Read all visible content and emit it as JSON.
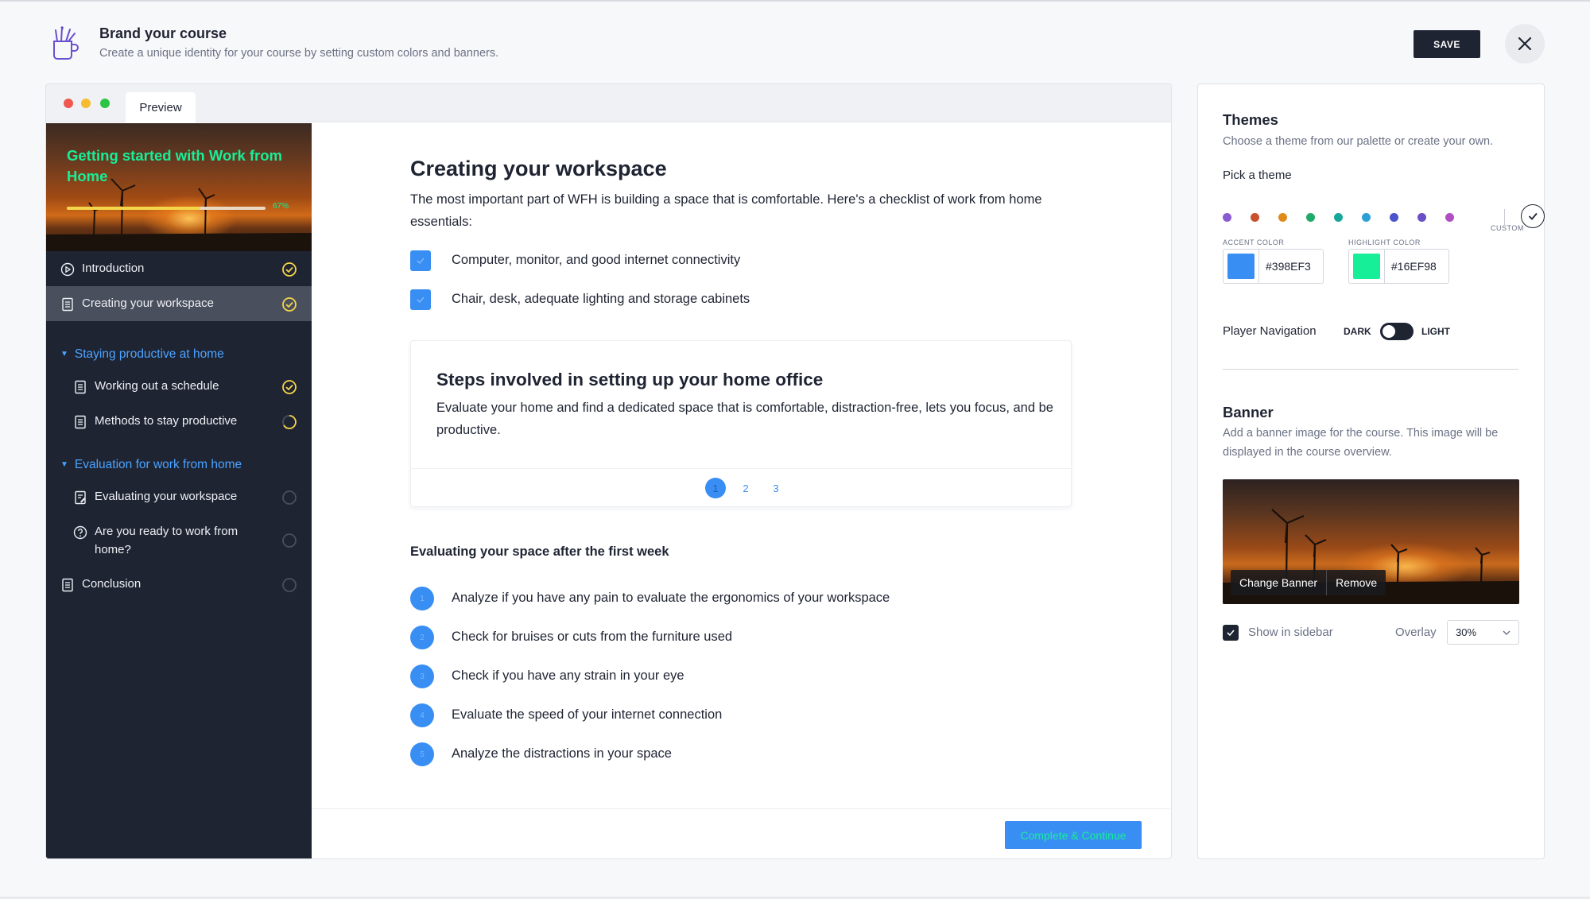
{
  "header": {
    "title": "Brand your course",
    "subtitle": "Create a unique identity for your course by setting custom colors and banners.",
    "save_label": "SAVE"
  },
  "preview": {
    "tab_label": "Preview",
    "sidebar": {
      "course_title": "Getting started with Work from Home",
      "progress_label": "67%",
      "progress_value": 0.67,
      "items": [
        {
          "label": "Introduction",
          "status": "complete"
        },
        {
          "label": "Creating your workspace",
          "status": "complete",
          "active": true
        },
        {
          "section": "Staying productive at home"
        },
        {
          "label": "Working out a schedule",
          "status": "complete"
        },
        {
          "label": "Methods to stay productive",
          "status": "in-progress"
        },
        {
          "section": "Evaluation for work from home"
        },
        {
          "label": "Evaluating your workspace",
          "status": "not-started"
        },
        {
          "label": "Are you ready to work from home?",
          "status": "not-started"
        },
        {
          "label": "Conclusion",
          "status": "not-started"
        }
      ]
    },
    "content": {
      "title": "Creating your workspace",
      "intro": "The most important part of WFH is building a space that is comfortable. Here's a checklist of work from home essentials:",
      "checklist": [
        "Computer, monitor, and good internet connectivity",
        "Chair, desk, adequate lighting and storage cabinets"
      ],
      "steps_card": {
        "title": "Steps involved in setting up your home office",
        "text": "Evaluate your home and find a dedicated space that is comfortable, distraction-free, lets you focus, and be productive.",
        "pages": [
          "1",
          "2",
          "3"
        ],
        "current_page": "1"
      },
      "eval_title": "Evaluating your space after the first week",
      "numbered": [
        {
          "n": "1",
          "text": "Analyze if you have any pain to evaluate the ergonomics of your workspace"
        },
        {
          "n": "2",
          "text": "Check for bruises or cuts from the furniture used"
        },
        {
          "n": "3",
          "text": "Check if you have any strain in your eye"
        },
        {
          "n": "4",
          "text": "Evaluate the speed of your internet connection"
        },
        {
          "n": "5",
          "text": "Analyze the distractions in your space"
        }
      ],
      "continue_label": "Complete & Continue"
    }
  },
  "panel": {
    "themes_title": "Themes",
    "themes_sub": "Choose a theme from our palette or create your own.",
    "pick_label": "Pick a theme",
    "theme_colors": [
      "#8a5cd0",
      "#c8512e",
      "#e08a1a",
      "#1faa6a",
      "#17a89a",
      "#2b9fd6",
      "#4a55c9",
      "#6b4fc6",
      "#b04fc2"
    ],
    "custom_label": "CUSTOM",
    "accent_caption": "ACCENT COLOR",
    "accent_value": "#398EF3",
    "accent_color": "#398ef3",
    "highlight_caption": "HIGHLIGHT COLOR",
    "highlight_value": "#16EF98",
    "highlight_color": "#16ef98",
    "nav_label": "Player Navigation",
    "nav_dark": "DARK",
    "nav_light": "LIGHT",
    "banner_title": "Banner",
    "banner_sub": "Add a banner image for the course. This image will be displayed in the course overview.",
    "change_banner": "Change Banner",
    "remove": "Remove",
    "show_in_sidebar": "Show in sidebar",
    "overlay_label": "Overlay",
    "overlay_value": "30%"
  }
}
